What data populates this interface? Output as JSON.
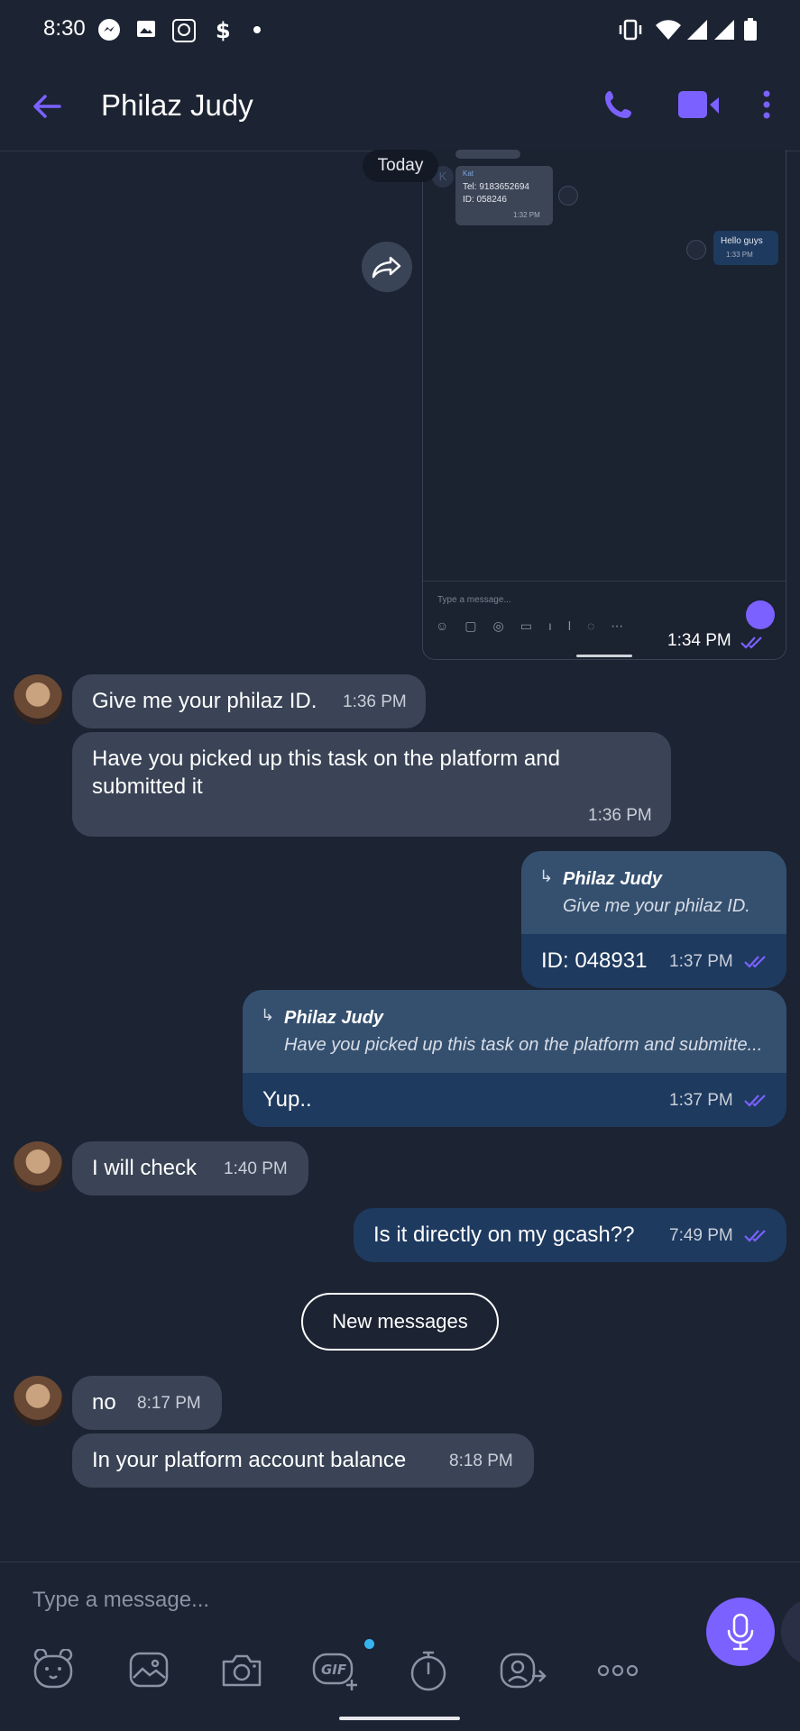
{
  "status_bar": {
    "time": "8:30"
  },
  "header": {
    "title": "Philaz Judy"
  },
  "date_chip": "Today",
  "embedded_screenshot": {
    "contact_initial": "K",
    "contact_name": "Kat",
    "tel_line": "Tel: 9183652694",
    "id_line": "ID: 058246",
    "msg_time": "1:32 PM",
    "outgoing_text": "Hello guys",
    "outgoing_time": "1:33 PM",
    "input_placeholder": "Type a message..."
  },
  "image_message_time": "1:34 PM",
  "messages": [
    {
      "dir": "in",
      "text": "Give me your philaz ID.",
      "time": "1:36 PM"
    },
    {
      "dir": "in",
      "text": "Have you picked up this task on the platform and submitted it",
      "time": "1:36 PM"
    },
    {
      "dir": "out",
      "quote_name": "Philaz Judy",
      "quote_text": "Give me your philaz ID.",
      "text": "ID: 048931",
      "time": "1:37 PM"
    },
    {
      "dir": "out",
      "quote_name": "Philaz Judy",
      "quote_text": "Have you picked up this task on the platform and submitte...",
      "text": "Yup..",
      "time": "1:37 PM"
    },
    {
      "dir": "in",
      "text": "I will check",
      "time": "1:40 PM"
    },
    {
      "dir": "out",
      "text": "Is it directly on my gcash??",
      "time": "7:49 PM"
    },
    {
      "dir": "in",
      "text": "no",
      "time": "8:17 PM"
    },
    {
      "dir": "in",
      "text": "In your platform account balance",
      "time": "8:18 PM"
    }
  ],
  "new_messages_label": "New messages",
  "composer": {
    "placeholder": "Type a message..."
  },
  "colors": {
    "background": "#1c2332",
    "incoming": "#3a4456",
    "outgoing": "#1e3a5f",
    "accent": "#7b61ff"
  }
}
